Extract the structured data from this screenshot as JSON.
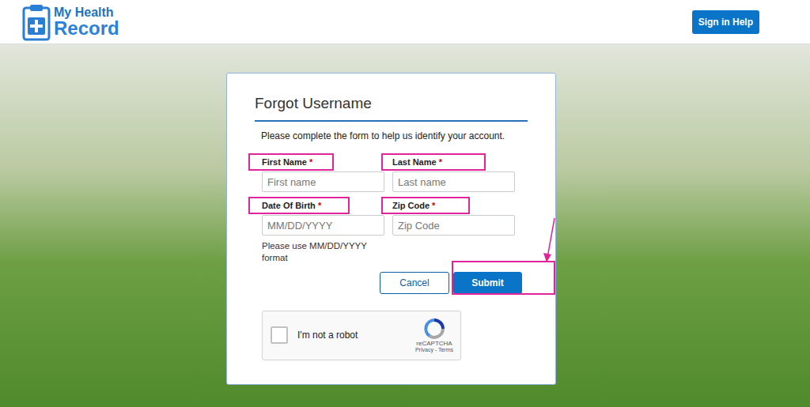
{
  "header": {
    "logo": {
      "line1": "My Health",
      "line2": "Record"
    },
    "help_button": "Sign in Help"
  },
  "form": {
    "title": "Forgot Username",
    "instructions": "Please complete the form to help us identify your account.",
    "fields": [
      {
        "label": "First Name",
        "required_mark": "*",
        "placeholder": "First name",
        "highlighted": true
      },
      {
        "label": "Last Name",
        "required_mark": "*",
        "placeholder": "Last name",
        "highlighted": true
      },
      {
        "label": "Date Of Birth",
        "required_mark": "*",
        "placeholder": "MM/DD/YYYY",
        "highlighted": true,
        "hint": "Please use MM/DD/YYYY format"
      },
      {
        "label": "Zip Code",
        "required_mark": "*",
        "placeholder": "Zip Code",
        "highlighted": true
      }
    ],
    "buttons": [
      {
        "label": "Cancel",
        "kind": "secondary",
        "highlighted": false
      },
      {
        "label": "Submit",
        "kind": "primary",
        "highlighted": true
      }
    ],
    "captcha": {
      "label": "I'm not a robot",
      "checked": false,
      "brand": "reCAPTCHA",
      "links": "Privacy - Terms"
    }
  }
}
